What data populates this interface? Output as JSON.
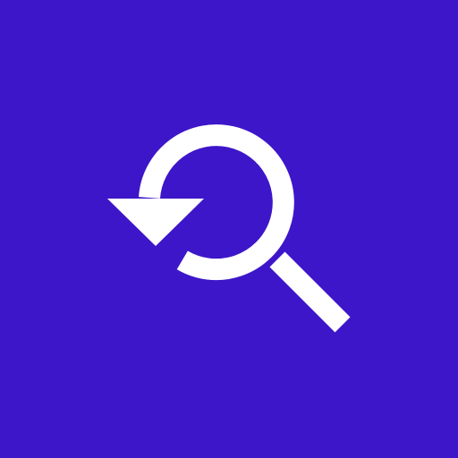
{
  "app_icon": {
    "icon": "search-history-icon",
    "background_color": "#3d16c9",
    "glyph_color": "#ffffff"
  }
}
